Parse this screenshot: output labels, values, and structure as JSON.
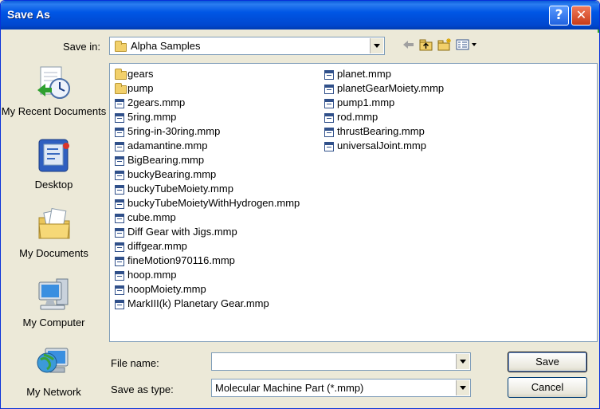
{
  "window": {
    "title": "Save As",
    "help_glyph": "?",
    "close_glyph": "✕"
  },
  "toolbar": {
    "save_in_label": "Save in:",
    "save_in_value": "Alpha Samples",
    "back_icon": "back-arrow-icon",
    "up_icon": "up-folder-icon",
    "new_folder_icon": "new-folder-icon",
    "views_icon": "views-menu-icon"
  },
  "places": [
    {
      "label": "My Recent Documents",
      "icon": "recent-documents-icon"
    },
    {
      "label": "Desktop",
      "icon": "desktop-icon"
    },
    {
      "label": "My Documents",
      "icon": "my-documents-icon"
    },
    {
      "label": "My Computer",
      "icon": "my-computer-icon"
    },
    {
      "label": "My Network",
      "icon": "my-network-icon"
    }
  ],
  "files": {
    "column1": [
      {
        "name": "gears",
        "type": "folder"
      },
      {
        "name": "pump",
        "type": "folder"
      },
      {
        "name": "2gears.mmp",
        "type": "file"
      },
      {
        "name": "5ring.mmp",
        "type": "file"
      },
      {
        "name": "5ring-in-30ring.mmp",
        "type": "file"
      },
      {
        "name": "adamantine.mmp",
        "type": "file"
      },
      {
        "name": "BigBearing.mmp",
        "type": "file"
      },
      {
        "name": "buckyBearing.mmp",
        "type": "file"
      },
      {
        "name": "buckyTubeMoiety.mmp",
        "type": "file"
      },
      {
        "name": "buckyTubeMoietyWithHydrogen.mmp",
        "type": "file"
      },
      {
        "name": "cube.mmp",
        "type": "file"
      },
      {
        "name": "Diff Gear with Jigs.mmp",
        "type": "file"
      },
      {
        "name": "diffgear.mmp",
        "type": "file"
      },
      {
        "name": "fineMotion970116.mmp",
        "type": "file"
      },
      {
        "name": "hoop.mmp",
        "type": "file"
      },
      {
        "name": "hoopMoiety.mmp",
        "type": "file"
      },
      {
        "name": "MarkIII(k) Planetary Gear.mmp",
        "type": "file"
      }
    ],
    "column2": [
      {
        "name": "planet.mmp",
        "type": "file"
      },
      {
        "name": "planetGearMoiety.mmp",
        "type": "file"
      },
      {
        "name": "pump1.mmp",
        "type": "file"
      },
      {
        "name": "rod.mmp",
        "type": "file"
      },
      {
        "name": "thrustBearing.mmp",
        "type": "file"
      },
      {
        "name": "universalJoint.mmp",
        "type": "file"
      }
    ]
  },
  "form": {
    "file_name_label": "File name:",
    "file_name_value": "",
    "save_type_label": "Save as type:",
    "save_type_value": "Molecular Machine Part (*.mmp)"
  },
  "buttons": {
    "save": "Save",
    "cancel": "Cancel"
  }
}
